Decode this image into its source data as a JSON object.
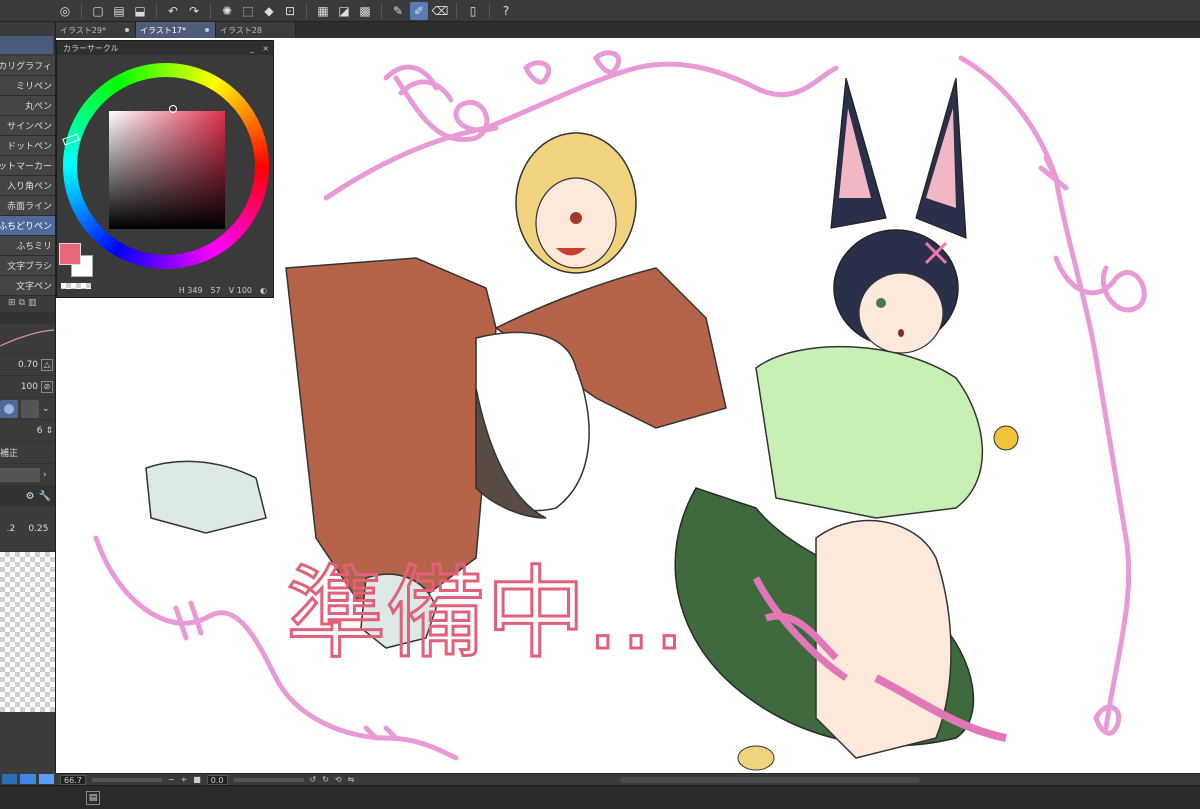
{
  "app": {
    "tabs": [
      {
        "label": "イラスト29*",
        "active": false
      },
      {
        "label": "イラスト17*",
        "active": true
      },
      {
        "label": "イラスト28",
        "active": false
      }
    ]
  },
  "toolbar": {
    "icons": [
      "clip-studio-icon",
      "new-file-icon",
      "open-file-icon",
      "save-icon",
      "undo-icon",
      "redo-icon",
      "spinner-icon",
      "select-icon",
      "fill-icon",
      "transform-icon",
      "grid-icon",
      "ruler-icon",
      "snap-icon",
      "pen-icon",
      "brush-icon",
      "eraser-icon",
      "device-icon",
      "help-icon"
    ]
  },
  "sub_tools": {
    "items": [
      "カリグラフィ",
      "ミリペン",
      "丸ペン",
      "サインペン",
      "ドットペン",
      "ットマーカー",
      "入り角ペン",
      "赤面ライン",
      "ふちどりペン",
      "ふちミリ",
      "文字ブラシ",
      "文字ペン"
    ],
    "selected_index": 8
  },
  "tool_props": {
    "value_a": "0.70",
    "value_b": "100",
    "value_c": "6",
    "label_correction": "補正",
    "value_d": ".2",
    "value_e": "0.25"
  },
  "color_panel": {
    "title": "カラーサークル",
    "minimize": "_",
    "close": "×",
    "h_value": "349",
    "s_value": "57",
    "v_value": "100",
    "main_color": "#e8667a",
    "sub_color": "#ffffff"
  },
  "canvas": {
    "text": "準備中…"
  },
  "statusbar": {
    "zoom": "66.7",
    "minus": "−",
    "plus": "+",
    "rotation": "0.0"
  }
}
